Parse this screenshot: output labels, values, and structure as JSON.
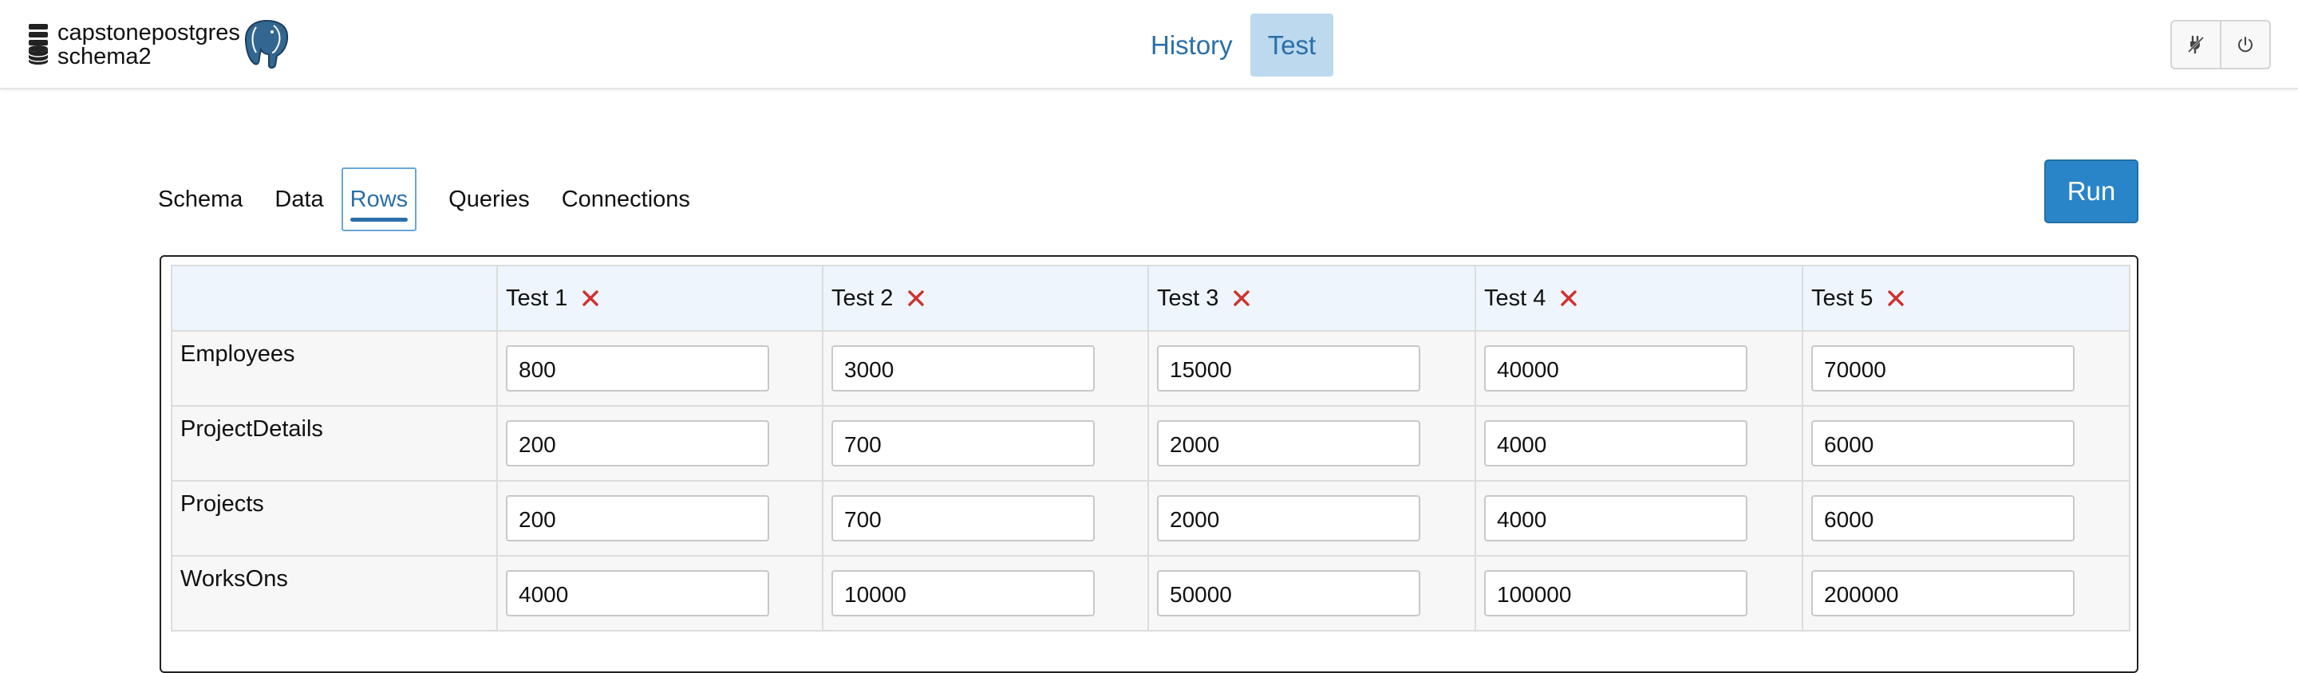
{
  "header": {
    "db_name": "capstonepostgres",
    "schema_name": "schema2",
    "nav": [
      "History",
      "Test"
    ],
    "active_nav": "Test",
    "tools": [
      "plug-icon",
      "power-icon"
    ]
  },
  "tabs": [
    "Schema",
    "Data",
    "Rows",
    "Queries",
    "Connections"
  ],
  "active_tab": "Rows",
  "run_label": "Run",
  "colors": {
    "accent": "#2a6fa8",
    "run_button": "#2a85c8",
    "active_nav_bg": "#bcd9ee",
    "header_cell_bg": "#eef5fc",
    "remove_x": "#d0312d"
  },
  "grid": {
    "columns": [
      "Test 1",
      "Test 2",
      "Test 3",
      "Test 4",
      "Test 5"
    ],
    "rows": [
      {
        "label": "Employees",
        "values": [
          "800",
          "3000",
          "15000",
          "40000",
          "70000"
        ]
      },
      {
        "label": "ProjectDetails",
        "values": [
          "200",
          "700",
          "2000",
          "4000",
          "6000"
        ]
      },
      {
        "label": "Projects",
        "values": [
          "200",
          "700",
          "2000",
          "4000",
          "6000"
        ]
      },
      {
        "label": "WorksOns",
        "values": [
          "4000",
          "10000",
          "50000",
          "100000",
          "200000"
        ]
      }
    ]
  }
}
